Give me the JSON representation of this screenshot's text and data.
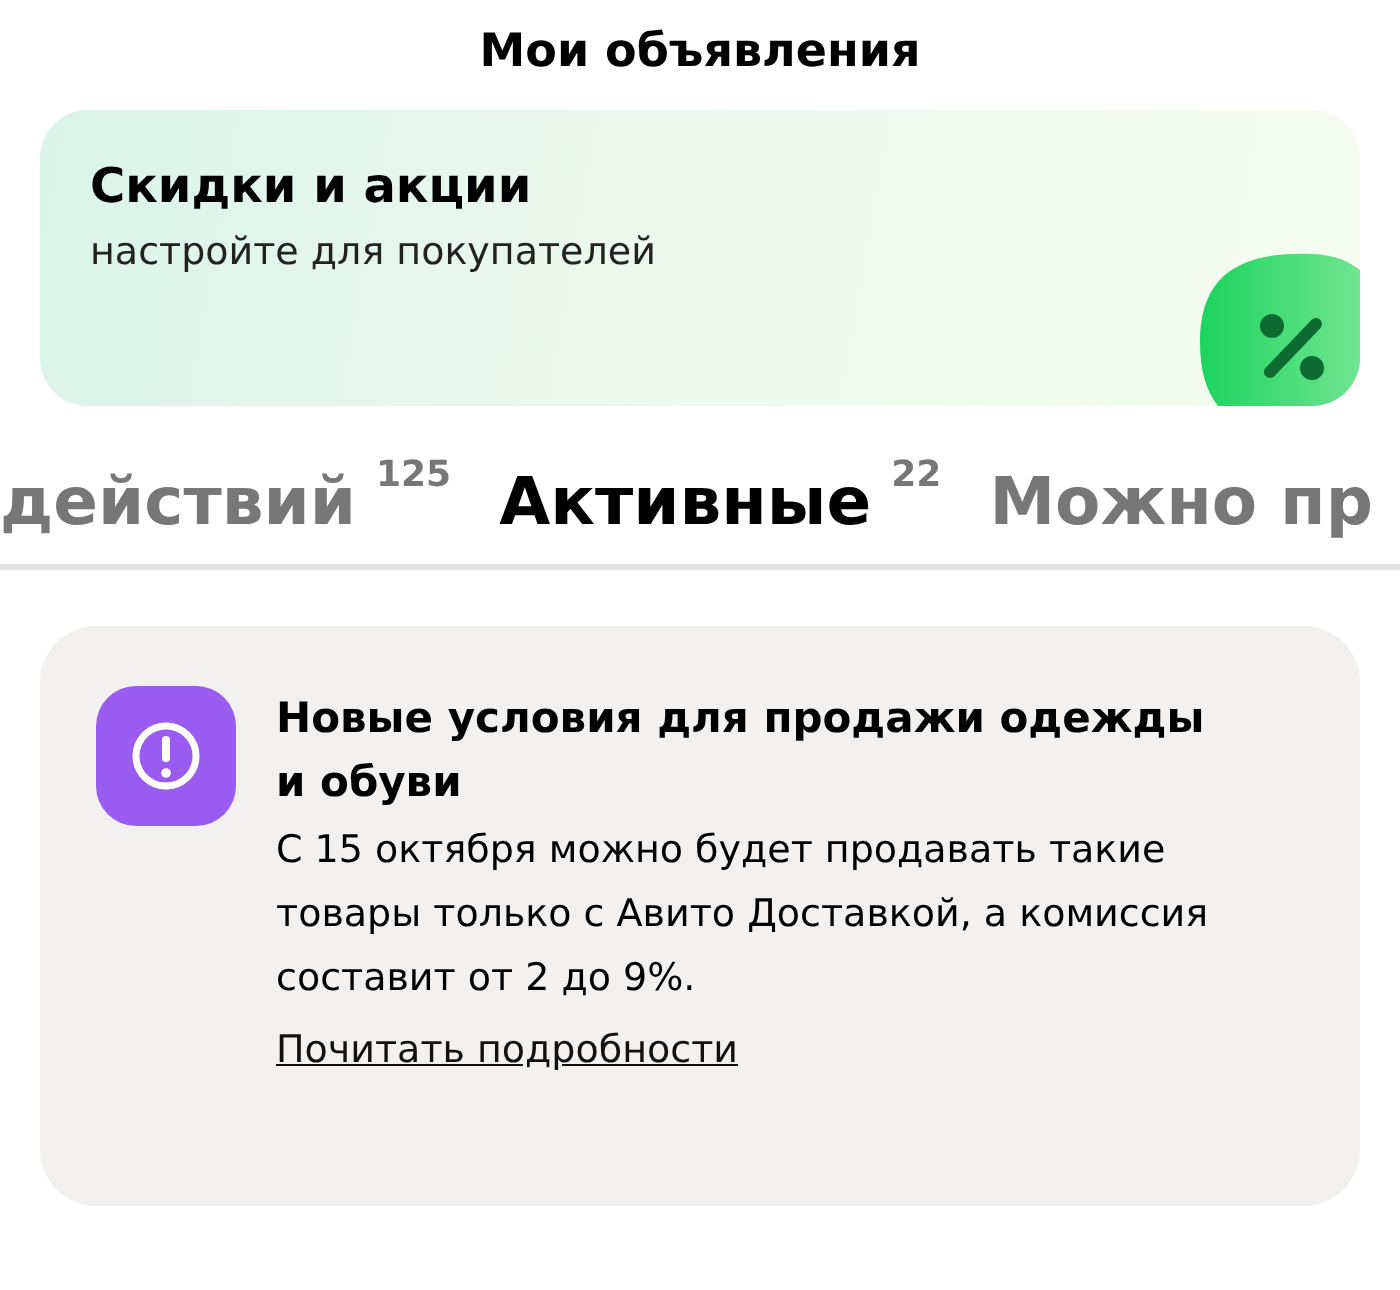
{
  "header": {
    "title": "Мои объявления"
  },
  "promo": {
    "title": "Скидки и акции",
    "subtitle": "настройте для покупателей"
  },
  "tabs": [
    {
      "label": "действий",
      "count": "125",
      "selected": false
    },
    {
      "label": "Активные",
      "count": "22",
      "selected": true
    },
    {
      "label": "Можно пр",
      "selected": false
    }
  ],
  "notice": {
    "title": "Новые условия для продажи одежды и обуви",
    "text": "С 15 октября можно будет продавать такие товары только с Авито Доставкой, а комиссия составит от 2 до 9%.",
    "link": "Почитать подробности"
  }
}
